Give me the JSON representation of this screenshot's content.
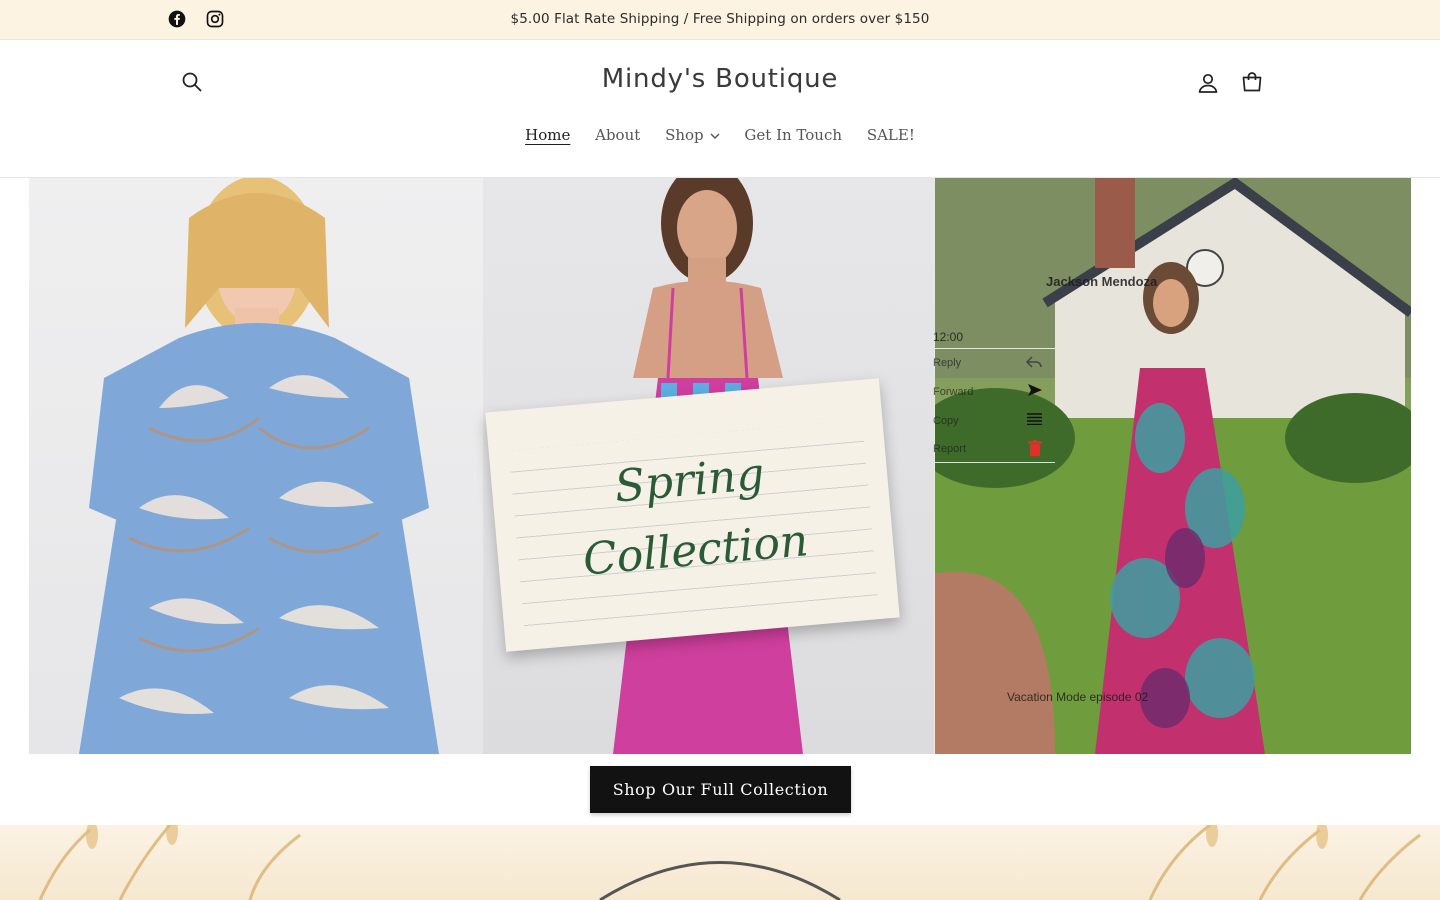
{
  "announcement": {
    "text": "$5.00 Flat Rate Shipping / Free Shipping on orders over $150",
    "social": [
      "facebook-icon",
      "instagram-icon"
    ]
  },
  "header": {
    "logo": "Mindy's Boutique",
    "icons": [
      "search-icon",
      "account-icon",
      "cart-icon"
    ]
  },
  "nav": {
    "items": [
      {
        "label": "Home",
        "active": true
      },
      {
        "label": "About",
        "active": false
      },
      {
        "label": "Shop",
        "active": false,
        "has_dropdown": true
      },
      {
        "label": "Get In Touch",
        "active": false
      },
      {
        "label": "SALE!",
        "active": false
      }
    ]
  },
  "hero": {
    "note_line1": "Spring",
    "note_line2": "Collection",
    "overlay": {
      "name": "Jackson Mendoza",
      "time": "12:00",
      "menu": [
        "Reply",
        "Forward",
        "Copy",
        "Report"
      ],
      "caption": "Vacation Mode episode 02"
    }
  },
  "cta": {
    "label": "Shop Our Full Collection"
  },
  "colors": {
    "announcement_bg": "#fdf3e3",
    "cta_bg": "#121212",
    "note_text": "#2b5a37"
  }
}
